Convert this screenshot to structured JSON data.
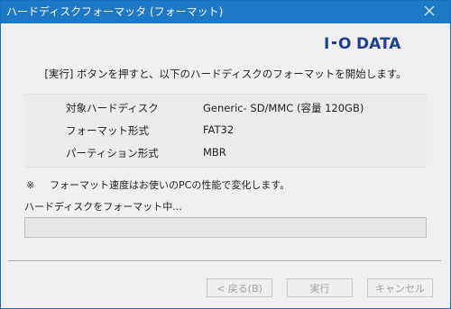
{
  "window": {
    "title": "ハードディスクフォーマッタ (フォーマット)",
    "close_symbol": "close-icon",
    "accent_color": "#1e78c8"
  },
  "logo": {
    "text": "I·O DATA",
    "icon": "io-data-logo",
    "color": "#1f3f97"
  },
  "instruction": "[実行] ボタンを押すと、以下のハードディスクのフォーマットを開始します。",
  "info": {
    "rows": [
      {
        "label": "対象ハードディスク",
        "value": "Generic- SD/MMC (容量 120GB)"
      },
      {
        "label": "フォーマット形式",
        "value": "FAT32"
      },
      {
        "label": "パーティション形式",
        "value": "MBR"
      }
    ]
  },
  "note": {
    "mark": "※",
    "text": "フォーマット速度はお使いのPCの性能で変化します。"
  },
  "status": "ハードディスクをフォーマット中...",
  "progress": {
    "fraction": 0,
    "fill_color": "#06b025"
  },
  "buttons": {
    "back": "< 戻る(B)",
    "run": "実行",
    "cancel": "キャンセル"
  }
}
